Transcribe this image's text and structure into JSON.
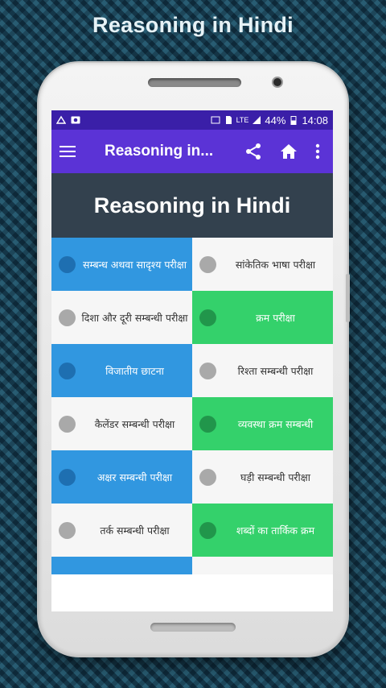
{
  "promo": {
    "title": "Reasoning in Hindi"
  },
  "status_bar": {
    "lte_label": "LTE",
    "battery_percent": "44%",
    "time": "14:08"
  },
  "app_bar": {
    "title": "Reasoning in...",
    "icons": [
      "menu-icon",
      "share-icon",
      "home-icon",
      "more-vert-icon"
    ]
  },
  "banner": {
    "title": "Reasoning in Hindi"
  },
  "topics": [
    {
      "label": "सम्बन्ध अथवा सादृश्य परीक्षा",
      "color": "blue"
    },
    {
      "label": "सांकेतिक भाषा परीक्षा",
      "color": "white"
    },
    {
      "label": "दिशा और दूरी सम्बन्धी परीक्षा",
      "color": "white"
    },
    {
      "label": "क्रम परीक्षा",
      "color": "green"
    },
    {
      "label": "विजातीय छाटना",
      "color": "blue"
    },
    {
      "label": "रिश्ता सम्बन्धी परीक्षा",
      "color": "white"
    },
    {
      "label": "कैलेंडर सम्बन्धी परीक्षा",
      "color": "white"
    },
    {
      "label": "व्यवस्था क्रम सम्बन्धी",
      "color": "green"
    },
    {
      "label": "अक्षर सम्बन्धी परीक्षा",
      "color": "blue"
    },
    {
      "label": "घड़ी सम्बन्धी परीक्षा",
      "color": "white"
    },
    {
      "label": "तर्क सम्बन्धी परीक्षा",
      "color": "white"
    },
    {
      "label": "शब्दों का तार्किक क्रम",
      "color": "green"
    }
  ],
  "colors": {
    "status_bar": "#3a1fa8",
    "app_bar": "#5b33d6",
    "banner": "#33414e",
    "blue": "#3197e0",
    "green": "#34d16b",
    "white": "#f6f6f6"
  }
}
